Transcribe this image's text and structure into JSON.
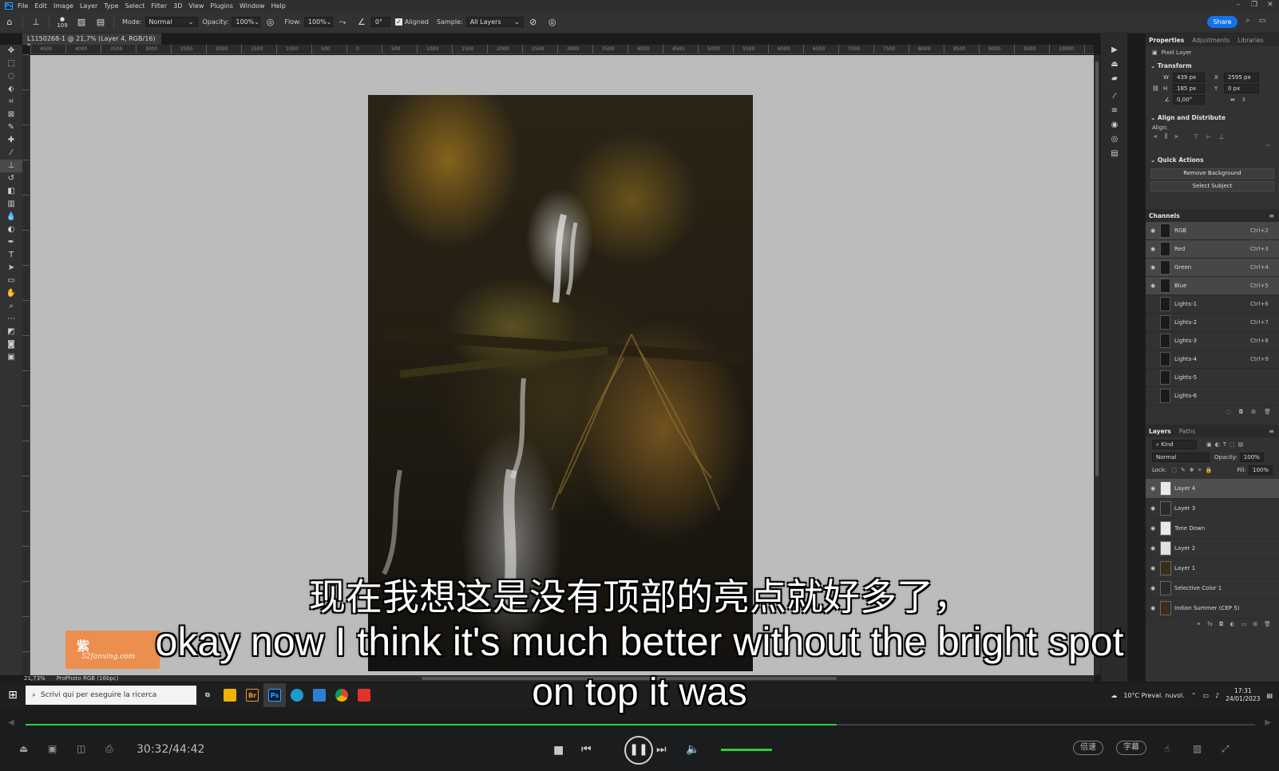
{
  "menubar": {
    "items": [
      "File",
      "Edit",
      "Image",
      "Layer",
      "Type",
      "Select",
      "Filter",
      "3D",
      "View",
      "Plugins",
      "Window",
      "Help"
    ]
  },
  "options": {
    "brush_size": "109",
    "mode_label": "Mode:",
    "mode_value": "Normal",
    "opacity_label": "Opacity:",
    "opacity_value": "100%",
    "flow_label": "Flow:",
    "flow_value": "100%",
    "angle_value": "0°",
    "aligned_label": "Aligned",
    "sample_label": "Sample:",
    "sample_value": "All Layers",
    "share_label": "Share"
  },
  "document": {
    "tab_title": "L1150268-1 @ 21,7% (Layer 4, RGB/16) *",
    "zoom": "21,73%",
    "profile": "ProPhoto RGB (16bpc)",
    "ruler_numbers": [
      "4500",
      "4000",
      "3500",
      "3000",
      "2500",
      "2000",
      "1500",
      "1000",
      "500",
      "0",
      "500",
      "1000",
      "1500",
      "2000",
      "2500",
      "3000",
      "3500",
      "4000",
      "4500",
      "5000",
      "5500",
      "6000",
      "6500",
      "7000",
      "7500",
      "8000",
      "8500",
      "9000",
      "9500",
      "10000"
    ]
  },
  "properties": {
    "tabs": [
      "Properties",
      "Adjustments",
      "Libraries"
    ],
    "kind": "Pixel Layer",
    "transform_title": "Transform",
    "w_label": "W",
    "w_value": "439 px",
    "x_label": "X",
    "x_value": "2595 px",
    "h_label": "H",
    "h_value": "185 px",
    "y_label": "Y",
    "y_value": "0 px",
    "angle_value": "0,00°",
    "align_title": "Align and Distribute",
    "align_label": "Align:",
    "quick_actions_title": "Quick Actions",
    "remove_bg_label": "Remove Background",
    "select_subject_label": "Select Subject"
  },
  "channels": {
    "title": "Channels",
    "items": [
      {
        "name": "RGB",
        "key": "Ctrl+2",
        "visible": true
      },
      {
        "name": "Red",
        "key": "Ctrl+3",
        "visible": true
      },
      {
        "name": "Green",
        "key": "Ctrl+4",
        "visible": true
      },
      {
        "name": "Blue",
        "key": "Ctrl+5",
        "visible": true
      },
      {
        "name": "Lights-1",
        "key": "Ctrl+6",
        "visible": false
      },
      {
        "name": "Lights-2",
        "key": "Ctrl+7",
        "visible": false
      },
      {
        "name": "Lights-3",
        "key": "Ctrl+8",
        "visible": false
      },
      {
        "name": "Lights-4",
        "key": "Ctrl+9",
        "visible": false
      },
      {
        "name": "Lights-5",
        "key": "",
        "visible": false
      },
      {
        "name": "Lights-6",
        "key": "",
        "visible": false
      }
    ]
  },
  "layers": {
    "tabs": [
      "Layers",
      "Paths"
    ],
    "kind_label": "Kind",
    "blend_mode": "Normal",
    "opacity_label": "Opacity:",
    "opacity_value": "100%",
    "lock_label": "Lock:",
    "fill_label": "Fill:",
    "fill_value": "100%",
    "items": [
      {
        "name": "Layer 4",
        "selected": true
      },
      {
        "name": "Layer 3",
        "selected": false
      },
      {
        "name": "Tone Down",
        "selected": false
      },
      {
        "name": "Layer 2",
        "selected": false
      },
      {
        "name": "Layer 1",
        "selected": false
      },
      {
        "name": "Selective Color 1",
        "selected": false
      },
      {
        "name": "Indian Summer (CEP 5)",
        "selected": false
      }
    ]
  },
  "taskbar": {
    "search_placeholder": "Scrivi qui per eseguire la ricerca",
    "weather": "10°C  Preval. nuvol.",
    "time": "17:31",
    "date": "24/01/2023",
    "apps": [
      "Br",
      "Ps"
    ]
  },
  "player": {
    "current_time": "30:32",
    "total_time": "44:42",
    "time_display": "30:32/44:42",
    "progress": 0.66,
    "speed_label": "倍速",
    "subtitle_label": "字幕",
    "accent": "#2ecc40"
  },
  "subtitles": {
    "zh": "现在我想这是没有顶部的亮点就好多了，",
    "en_line1": "okay now I think it's much better without the bright spot",
    "en_line2": "on top it was"
  },
  "watermark": {
    "zh": "紫",
    "url": "52fanxing.com"
  }
}
